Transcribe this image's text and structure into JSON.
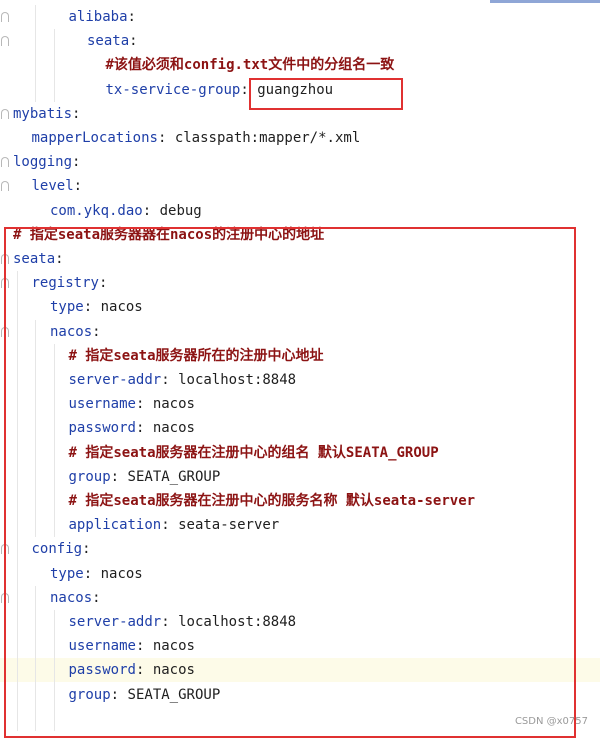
{
  "code": {
    "lines": [
      {
        "indent": 3,
        "key": "alibaba",
        "sep": ":",
        "value": "",
        "comment": ""
      },
      {
        "indent": 4,
        "key": "seata",
        "sep": ":",
        "value": "",
        "comment": ""
      },
      {
        "indent": 5,
        "key": "",
        "sep": "",
        "value": "",
        "comment": "#该值必须和config.txt文件中的分组名一致"
      },
      {
        "indent": 5,
        "key": "tx-service-group",
        "sep": ":",
        "value": "guangzhou",
        "comment": ""
      },
      {
        "indent": 0,
        "key": "mybatis",
        "sep": ":",
        "value": "",
        "comment": ""
      },
      {
        "indent": 1,
        "key": "mapperLocations",
        "sep": ":",
        "value": "classpath:mapper/*.xml",
        "comment": ""
      },
      {
        "indent": 0,
        "key": "logging",
        "sep": ":",
        "value": "",
        "comment": ""
      },
      {
        "indent": 1,
        "key": "level",
        "sep": ":",
        "value": "",
        "comment": ""
      },
      {
        "indent": 2,
        "key": "com.ykq.dao",
        "sep": ":",
        "value": "debug",
        "comment": ""
      },
      {
        "indent": 0,
        "key": "",
        "sep": "",
        "value": "",
        "comment": "# 指定seata服务器器在nacos的注册中心的地址"
      },
      {
        "indent": 0,
        "key": "seata",
        "sep": ":",
        "value": "",
        "comment": ""
      },
      {
        "indent": 1,
        "key": "registry",
        "sep": ":",
        "value": "",
        "comment": ""
      },
      {
        "indent": 2,
        "key": "type",
        "sep": ":",
        "value": "nacos",
        "comment": ""
      },
      {
        "indent": 2,
        "key": "nacos",
        "sep": ":",
        "value": "",
        "comment": ""
      },
      {
        "indent": 3,
        "key": "",
        "sep": "",
        "value": "",
        "comment": "# 指定seata服务器所在的注册中心地址"
      },
      {
        "indent": 3,
        "key": "server-addr",
        "sep": ":",
        "value": "localhost:8848",
        "comment": ""
      },
      {
        "indent": 3,
        "key": "username",
        "sep": ":",
        "value": "nacos",
        "comment": ""
      },
      {
        "indent": 3,
        "key": "password",
        "sep": ":",
        "value": "nacos",
        "comment": ""
      },
      {
        "indent": 3,
        "key": "",
        "sep": "",
        "value": "",
        "comment": "# 指定seata服务器在注册中心的组名 默认SEATA_GROUP"
      },
      {
        "indent": 3,
        "key": "group",
        "sep": ":",
        "value": "SEATA_GROUP",
        "comment": ""
      },
      {
        "indent": 3,
        "key": "",
        "sep": "",
        "value": "",
        "comment": "# 指定seata服务器在注册中心的服务名称 默认seata-server"
      },
      {
        "indent": 3,
        "key": "application",
        "sep": ":",
        "value": "seata-server",
        "comment": ""
      },
      {
        "indent": 1,
        "key": "config",
        "sep": ":",
        "value": "",
        "comment": ""
      },
      {
        "indent": 2,
        "key": "type",
        "sep": ":",
        "value": "nacos",
        "comment": ""
      },
      {
        "indent": 2,
        "key": "nacos",
        "sep": ":",
        "value": "",
        "comment": ""
      },
      {
        "indent": 3,
        "key": "server-addr",
        "sep": ":",
        "value": "localhost:8848",
        "comment": ""
      },
      {
        "indent": 3,
        "key": "username",
        "sep": ":",
        "value": "nacos",
        "comment": ""
      },
      {
        "indent": 3,
        "key": "password",
        "sep": ":",
        "value": "nacos",
        "comment": ""
      },
      {
        "indent": 3,
        "key": "group",
        "sep": ":",
        "value": "SEATA_GROUP",
        "comment": ""
      },
      {
        "indent": 3,
        "key": "",
        "sep": "",
        "value": "",
        "comment": ""
      }
    ]
  },
  "watermark": "CSDN @x0757",
  "colors": {
    "key": "#1f3fa8",
    "comment": "#8c1313",
    "highlight_box": "#e03131",
    "current_line": "#fdfbe8"
  }
}
